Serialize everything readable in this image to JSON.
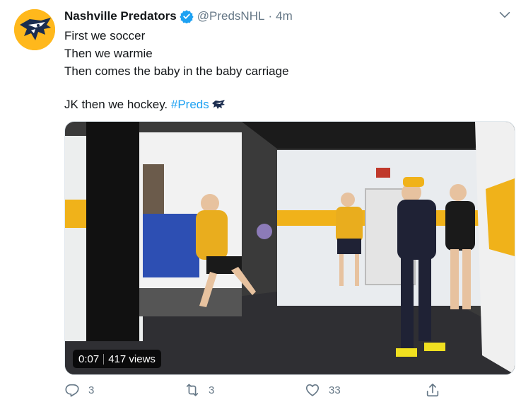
{
  "tweet": {
    "author_name": "Nashville Predators",
    "author_handle": "@PredsNHL",
    "separator": "·",
    "timestamp": "4m",
    "lines": [
      "First we soccer",
      "Then we warmie",
      "Then comes the baby in the baby carriage"
    ],
    "last_line_text": "JK then we hockey. ",
    "hashtag": "#Preds"
  },
  "media": {
    "duration": "0:07",
    "views": "417 views"
  },
  "actions": {
    "reply_count": "3",
    "retweet_count": "3",
    "like_count": "33"
  },
  "icons": {
    "avatar": "predators-logo-icon",
    "verified": "verified-badge-icon",
    "caret": "chevron-down-icon",
    "reply": "reply-icon",
    "retweet": "retweet-icon",
    "like": "heart-icon",
    "share": "share-icon"
  },
  "colors": {
    "brand_gold": "#ffb81c",
    "link_blue": "#1da1f2",
    "secondary_text": "#657786"
  }
}
